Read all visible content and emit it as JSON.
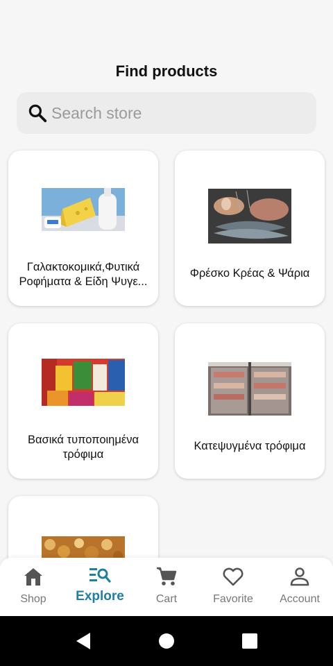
{
  "header": {
    "title": "Find products"
  },
  "search": {
    "placeholder": "Search store",
    "icon": "search-icon"
  },
  "categories": [
    {
      "label": "Γαλακτοκομικά,Φυτικά Ροφήματα & Είδη Ψυγε..."
    },
    {
      "label": "Φρέσκο Κρέας & Ψάρια"
    },
    {
      "label": "Βασικά τυποποιημένα τρόφιμα"
    },
    {
      "label": "Κατεψυγμένα τρόφιμα"
    },
    {
      "label": ""
    }
  ],
  "bottom_nav": {
    "items": [
      {
        "label": "Shop",
        "icon": "shop-icon"
      },
      {
        "label": "Explore",
        "icon": "explore-icon",
        "active": true
      },
      {
        "label": "Cart",
        "icon": "cart-icon"
      },
      {
        "label": "Favorite",
        "icon": "heart-icon"
      },
      {
        "label": "Account",
        "icon": "account-icon"
      }
    ]
  },
  "colors": {
    "accent": "#1f7ea6",
    "background": "#f6f6f6",
    "card": "#ffffff"
  }
}
